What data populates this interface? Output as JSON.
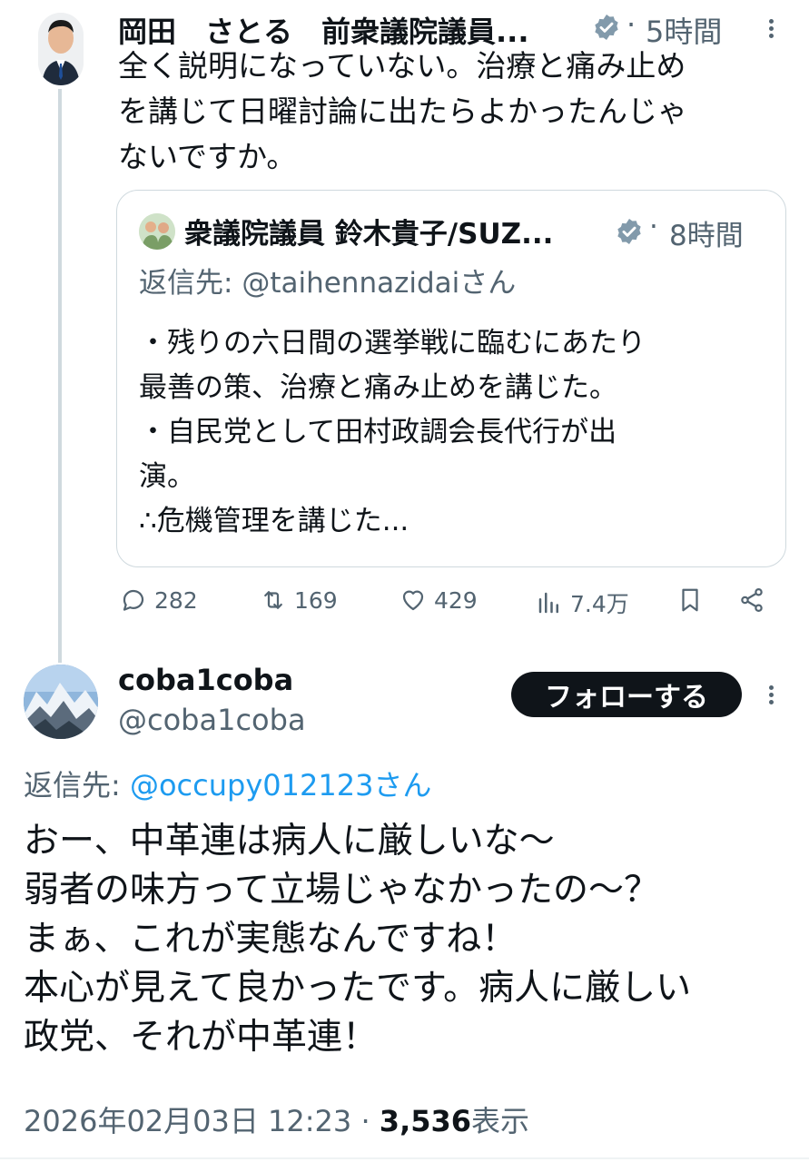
{
  "tweet1": {
    "name": "岡田　さとる　前衆議院議員...",
    "time": "5時間",
    "lines": [
      "全く説明になっていない。治療と痛み止め",
      "を講じて日曜討論に出たらよかったんじゃ",
      "ないですか。"
    ],
    "quote": {
      "name": "衆議院議員 鈴木貴子/SUZ...",
      "time": "8時間",
      "reply_prefix": "返信先: ",
      "reply_handle": "@taihennazidai",
      "reply_suffix": "さん",
      "lines": [
        "・残りの六日間の選挙戦に臨むにあたり",
        "最善の策、治療と痛み止めを講じた。",
        "・自民党として田村政調会長代行が出",
        "演。",
        "∴危機管理を講じた..."
      ]
    },
    "actions": {
      "replies": "282",
      "retweets": "169",
      "likes": "429",
      "views": "7.4万"
    }
  },
  "tweet2": {
    "name": "coba1coba",
    "handle": "@coba1coba",
    "follow_label": "フォローする",
    "reply_prefix": "返信先: ",
    "reply_handle": "@occupy012123さん",
    "lines": [
      "おー、中革連は病人に厳しいな〜",
      "弱者の味方って立場じゃなかったの〜？",
      "まぁ、これが実態なんですね！",
      "本心が見えて良かったです。病人に厳しい",
      "政党、それが中革連！"
    ],
    "timestamp": "2026年02月03日 12:23",
    "views_count": "3,536",
    "views_label": "表示"
  }
}
